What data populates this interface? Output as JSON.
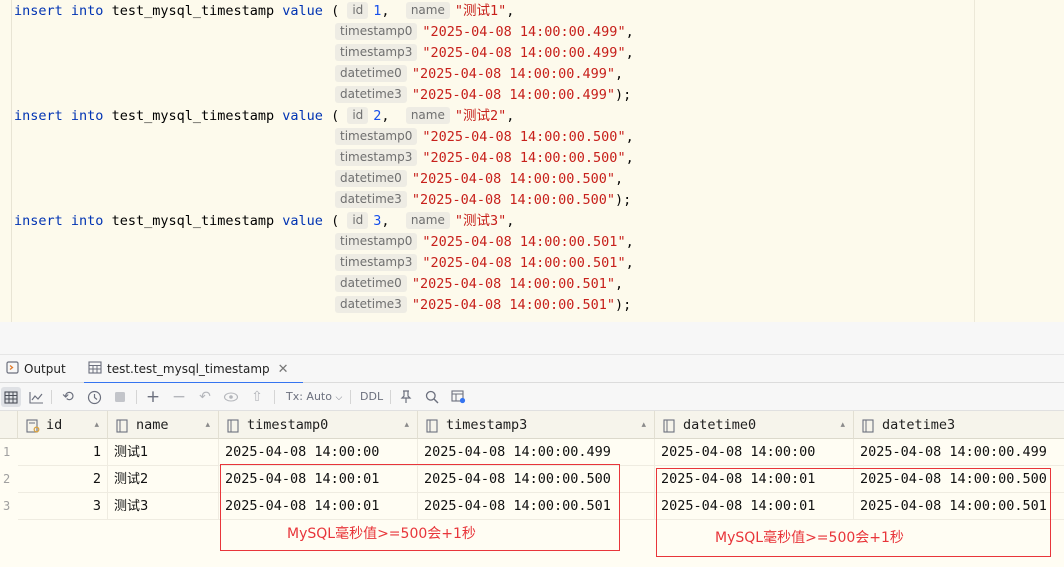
{
  "editor": {
    "statements": [
      {
        "keyword_insert": "insert",
        "keyword_into": "into",
        "table": "test_mysql_timestamp",
        "keyword_value": "value",
        "id": "1",
        "name": "\"测试1\"",
        "ts0": "\"2025-04-08 14:00:00.499\"",
        "ts3": "\"2025-04-08 14:00:00.499\"",
        "dt0": "\"2025-04-08 14:00:00.499\"",
        "dt3": "\"2025-04-08 14:00:00.499\""
      },
      {
        "keyword_insert": "insert",
        "keyword_into": "into",
        "table": "test_mysql_timestamp",
        "keyword_value": "value",
        "id": "2",
        "name": "\"测试2\"",
        "ts0": "\"2025-04-08 14:00:00.500\"",
        "ts3": "\"2025-04-08 14:00:00.500\"",
        "dt0": "\"2025-04-08 14:00:00.500\"",
        "dt3": "\"2025-04-08 14:00:00.500\""
      },
      {
        "keyword_insert": "insert",
        "keyword_into": "into",
        "table": "test_mysql_timestamp",
        "keyword_value": "value",
        "id": "3",
        "name": "\"测试3\"",
        "ts0": "\"2025-04-08 14:00:00.501\"",
        "ts3": "\"2025-04-08 14:00:00.501\"",
        "dt0": "\"2025-04-08 14:00:00.501\"",
        "dt3": "\"2025-04-08 14:00:00.501\""
      }
    ],
    "hints": {
      "id": "id",
      "name": "name",
      "ts0": "timestamp0",
      "ts3": "timestamp3",
      "dt0": "datetime0",
      "dt3": "datetime3"
    }
  },
  "tabs": {
    "output": "Output",
    "table": "test.test_mysql_timestamp"
  },
  "toolbar": {
    "tx_mode": "Tx: Auto",
    "ddl": "DDL"
  },
  "grid": {
    "columns": [
      "id",
      "name",
      "timestamp0",
      "timestamp3",
      "datetime0",
      "datetime3"
    ],
    "rows": [
      {
        "num": "1",
        "id": "1",
        "name": "测试1",
        "ts0": "2025-04-08 14:00:00",
        "ts3": "2025-04-08 14:00:00.499",
        "dt0": "2025-04-08 14:00:00",
        "dt3": "2025-04-08 14:00:00.499"
      },
      {
        "num": "2",
        "id": "2",
        "name": "测试2",
        "ts0": "2025-04-08 14:00:01",
        "ts3": "2025-04-08 14:00:00.500",
        "dt0": "2025-04-08 14:00:01",
        "dt3": "2025-04-08 14:00:00.500"
      },
      {
        "num": "3",
        "id": "3",
        "name": "测试3",
        "ts0": "2025-04-08 14:00:01",
        "ts3": "2025-04-08 14:00:00.501",
        "dt0": "2025-04-08 14:00:01",
        "dt3": "2025-04-08 14:00:00.501"
      }
    ]
  },
  "annotations": {
    "left": "MySQL毫秒值>=500会+1秒",
    "right": "MySQL毫秒值>=500会+1秒"
  },
  "colors": {
    "keyword": "#0033b3",
    "string": "#c7201b",
    "number": "#1750eb",
    "annotation": "#e8353a",
    "tab_active": "#3574f0"
  }
}
